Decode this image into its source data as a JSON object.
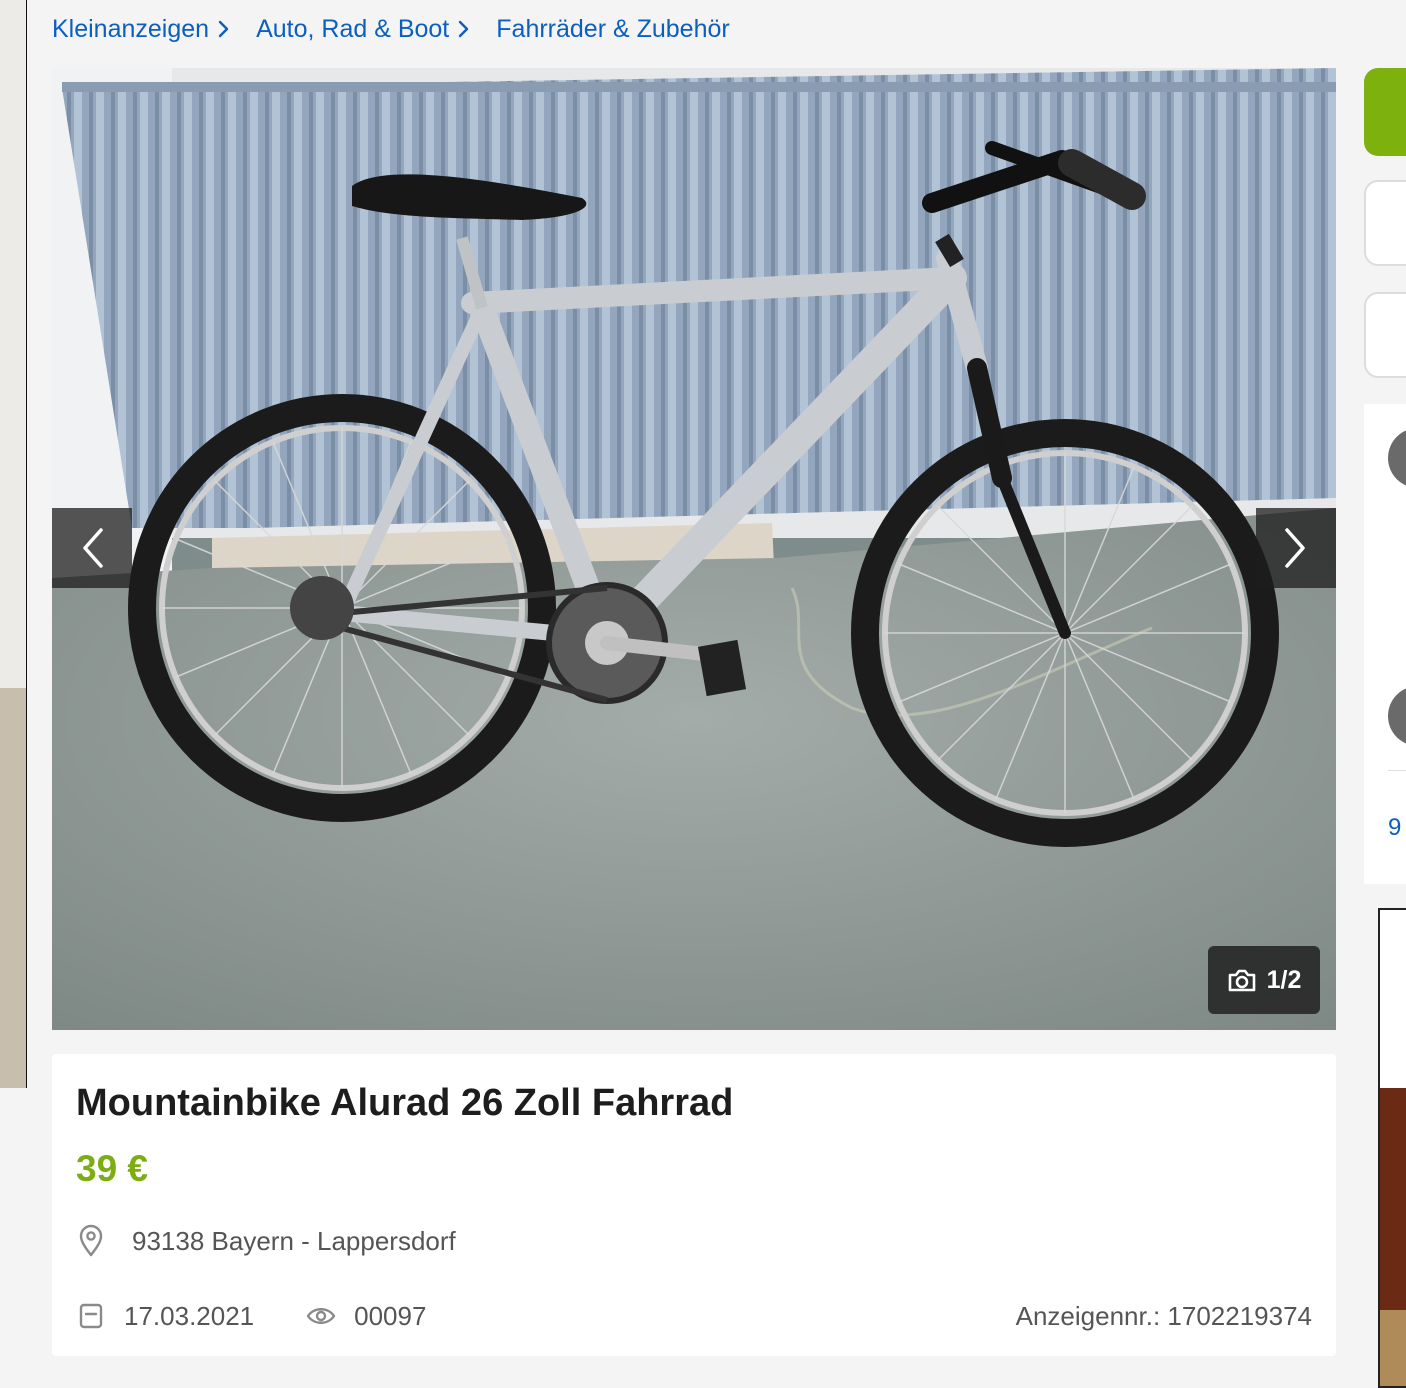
{
  "breadcrumb": {
    "items": [
      {
        "label": "Kleinanzeigen"
      },
      {
        "label": "Auto, Rad & Boot"
      },
      {
        "label": "Fahrräder & Zubehör"
      }
    ]
  },
  "gallery": {
    "counter": "1/2",
    "prev_icon": "chevron-left-icon",
    "next_icon": "chevron-right-icon",
    "counter_icon": "camera-icon"
  },
  "listing": {
    "title": "Mountainbike Alurad 26 Zoll Fahrrad",
    "price": "39 €",
    "location": "93138 Bayern - Lappersdorf",
    "date": "17.03.2021",
    "views": "00097",
    "ad_number": "Anzeigennr.: 1702219374"
  },
  "sidebar": {
    "partial_number": "9"
  },
  "colors": {
    "link": "#0a5fbf",
    "price": "#7cae14",
    "accent_green": "#7cb10e",
    "background": "#f4f4f4"
  }
}
